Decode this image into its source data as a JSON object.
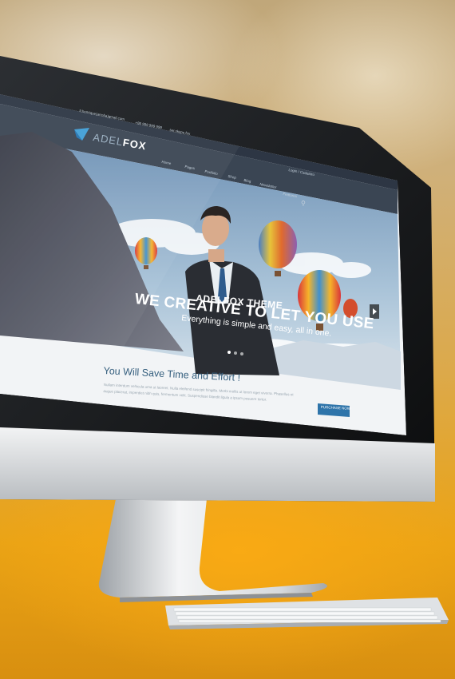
{
  "site": {
    "logo_part1": "ADEL",
    "logo_part2": "FOX",
    "email": "ti.henrique(arroba)gmail.com",
    "phone": "+86 999 999 999",
    "skype": "ser.skype.fox"
  },
  "nav": {
    "items": [
      "Home",
      "Pages",
      "Portfolio",
      "Shop",
      "Blog",
      "Newsletter",
      "Features"
    ],
    "login": "Login / Cadastro"
  },
  "hero": {
    "small_title": "ADELFOX THEME",
    "title": "WE CREATIVE TO LET YOU USE",
    "subtitle": "Everything is simple and easy, all in one."
  },
  "content": {
    "heading": "You Will Save Time and Effort !",
    "body": "Nullam interdum vehicula urna ut laoreet. Nulla eleifend suscipit fringilla. Morbi mollis ut lorem eget viverra. Phasellus et augue placerat, imperdiet nibh quis, fermentum velit. Suspendisse blandit ligula a ipsum posuere tortor.",
    "button": "PURCHASE NOW!"
  },
  "colors": {
    "accent": "#2e74aa",
    "brand": "#4aa3d8",
    "background": "#e9a013"
  }
}
